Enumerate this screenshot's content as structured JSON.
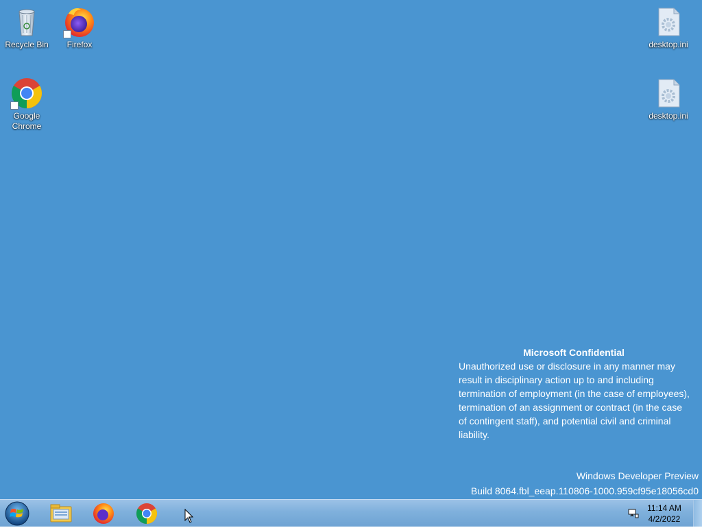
{
  "desktop": {
    "background_color": "#4a95d1",
    "icons": [
      {
        "label": "Recycle Bin",
        "icon": "recycle-bin-icon"
      },
      {
        "label": "Firefox",
        "icon": "firefox-icon"
      },
      {
        "label": "Google Chrome",
        "icon": "chrome-icon"
      },
      {
        "label": "desktop.ini",
        "icon": "settings-file-icon"
      },
      {
        "label": "desktop.ini",
        "icon": "settings-file-icon"
      }
    ],
    "confidential": {
      "heading": "Microsoft Confidential",
      "body": "Unauthorized use or disclosure in any manner may result in disciplinary action up to and including termination of employment (in the case of employees), termination of an assignment or contract (in the case of contingent staff), and potential civil and criminal liability."
    },
    "watermark": {
      "line1": "Windows Developer Preview",
      "line2": "Build 8064.fbl_eeap.110806-1000.959cf95e18056cd0"
    }
  },
  "taskbar": {
    "start_icon": "windows-start-orb-icon",
    "apps": [
      {
        "name": "File Explorer",
        "icon": "file-explorer-icon"
      },
      {
        "name": "Firefox",
        "icon": "firefox-icon"
      },
      {
        "name": "Google Chrome",
        "icon": "chrome-icon"
      }
    ],
    "tray": {
      "network_icon": "network-icon",
      "time": "11:14 AM",
      "date": "4/2/2022"
    }
  }
}
